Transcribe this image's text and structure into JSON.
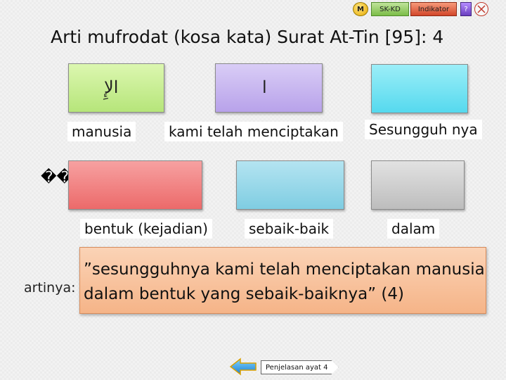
{
  "nav": {
    "m_label": "M",
    "sk_label": "SK-KD",
    "indikator_label": "Indikator",
    "help_label": "?",
    "close_icon": "close-circle-icon"
  },
  "title": "Arti mufrodat (kosa kata) Surat At-Tin [95]: 4",
  "words_row1": [
    {
      "arabic": "ﺍﻹِ",
      "meaning": "manusia",
      "color": "#c6ee92"
    },
    {
      "arabic": "ﺍ",
      "meaning": "kami telah menciptakan",
      "color": "#c6b6f0"
    },
    {
      "arabic": "",
      "meaning": "Sesungguh nya",
      "color": "#72e2f2"
    }
  ],
  "garbled_text": "���",
  "words_row2": [
    {
      "meaning": "bentuk (kejadian)",
      "color": "#f08484"
    },
    {
      "meaning": "sebaik-baik",
      "color": "#97d7ea"
    },
    {
      "meaning": "dalam",
      "color": "#d0d0d0"
    }
  ],
  "artinya": {
    "label": "artinya:",
    "line1": "”sesungguhnya kami telah menciptakan manusia",
    "line2": "dalam  bentuk  yang sebaik-baiknya” (4)",
    "color": "#f8c4a0"
  },
  "footer": {
    "arrow_icon": "arrow-left-icon",
    "explanation_button": "Penjelasan ayat 4"
  }
}
